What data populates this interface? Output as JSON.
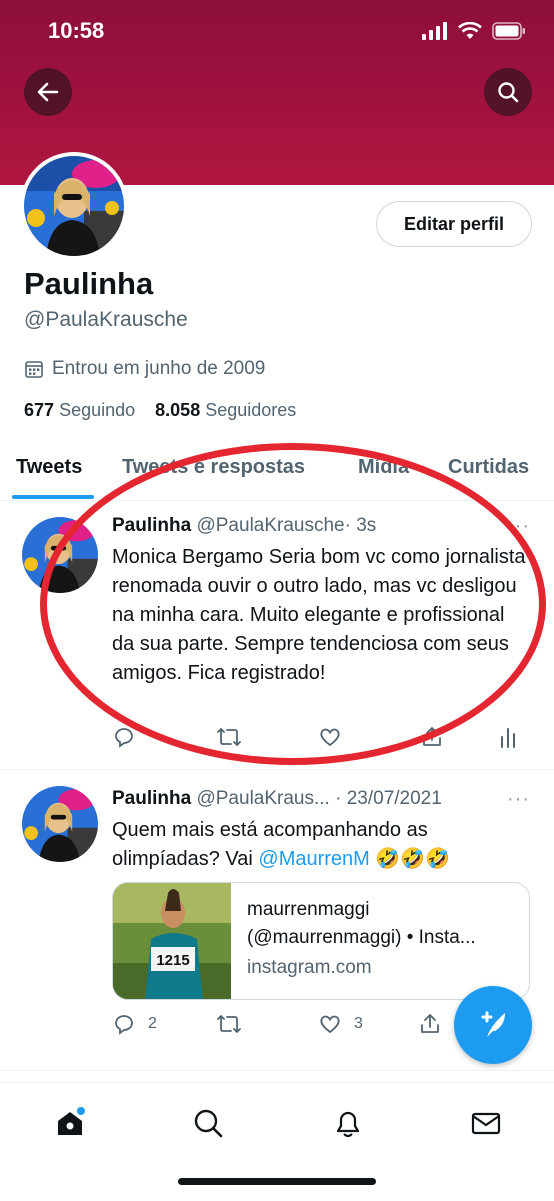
{
  "status": {
    "time": "10:58"
  },
  "profile": {
    "name": "Paulinha",
    "handle": "@PaulaKrausche",
    "joined": "Entrou em junho de 2009",
    "following_count": "677",
    "following_label": "Seguindo",
    "followers_count": "8.058",
    "followers_label": "Seguidores",
    "edit_label": "Editar perfil"
  },
  "tabs": [
    {
      "label": "Tweets",
      "active": true
    },
    {
      "label": "Tweets e respostas"
    },
    {
      "label": "Mídia"
    },
    {
      "label": "Curtidas"
    }
  ],
  "tweets": [
    {
      "name": "Paulinha",
      "handle": "@PaulaKrausche",
      "time": "· 3s",
      "text": "Monica Bergamo Seria bom vc como jornalista renomada ouvir o outro lado, mas vc desligou na minha cara. Muito elegante e profissional da sua parte. Sempre tendenciosa com seus amigos. Fica registrado!",
      "more": "···"
    },
    {
      "name": "Paulinha",
      "handle": "@PaulaKraus...",
      "time": "· 23/07/2021",
      "text_before": "Quem mais está acompanhando as olimpíadas? Vai ",
      "mention": "@MaurrenM",
      "emoji": " 🤣🤣🤣",
      "more": "···",
      "card": {
        "line1": "maurrenmaggi",
        "line2": "(@maurrenmaggi) • Insta...",
        "domain": "instagram.com",
        "bib": "1215"
      },
      "replies": "2",
      "likes": "3"
    }
  ],
  "colors": {
    "accent": "#1d9bf0",
    "banner": "#a3123f",
    "annotation": "#e3262f"
  }
}
